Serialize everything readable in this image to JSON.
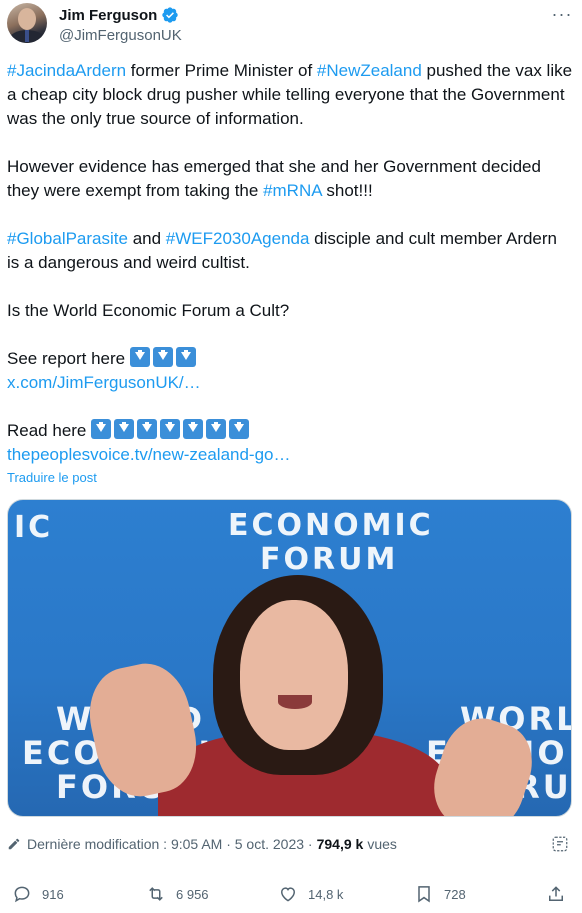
{
  "author": {
    "name": "Jim Ferguson",
    "handle": "@JimFergusonUK"
  },
  "tweet": {
    "p1": {
      "tag1": "#JacindaArdern",
      "t1": " former Prime Minister of ",
      "tag2": "#NewZealand",
      "t2": " pushed the vax like a cheap city block drug pusher while telling everyone that the Government was the only true source of information."
    },
    "p2": {
      "t1": "However evidence has emerged that she and her Government decided they were exempt from taking the ",
      "tag1": "#mRNA",
      "t2": " shot!!!"
    },
    "p3": {
      "tag1": "#GlobalParasite",
      "t1": " and ",
      "tag2": "#WEF2030Agenda",
      "t2": " disciple and cult member Ardern is a dangerous and weird cultist."
    },
    "p4": "Is the World Economic Forum a Cult?",
    "p5": {
      "label": "See report here ",
      "link": "x.com/JimFergusonUK/…"
    },
    "p6": {
      "label": "Read here ",
      "link": "thepeoplesvoice.tv/new-zealand-go…"
    },
    "translate": "Traduire le post"
  },
  "media": {
    "banner_top_line1": "ECONOMIC",
    "banner_top_line2": "FORUM",
    "banner_top_left": "IC",
    "banner_left_line1": "WORLD",
    "banner_left_line2": "ECONOMIC",
    "banner_left_line3": "FORUM",
    "banner_right_line1": "WORL",
    "banner_right_line2": "ECONO",
    "banner_right_line3": "FORU"
  },
  "meta": {
    "prefix": "Dernière modification : 9:05 AM · 5 oct. 2023 ·",
    "views_count": "794,9 k",
    "views_label": "vues"
  },
  "actions": {
    "replies": "916",
    "reposts": "6 956",
    "likes": "14,8 k",
    "bookmarks": "728"
  },
  "colors": {
    "link": "#1d9bf0",
    "text": "#0f1419",
    "secondary": "#536471",
    "verified": "#1d9bf0"
  },
  "icons": [
    "verified-badge-icon",
    "more-icon",
    "arrow-down-emoji-icon",
    "pencil-icon",
    "grok-icon",
    "reply-icon",
    "repost-icon",
    "like-icon",
    "bookmark-icon",
    "share-icon"
  ]
}
